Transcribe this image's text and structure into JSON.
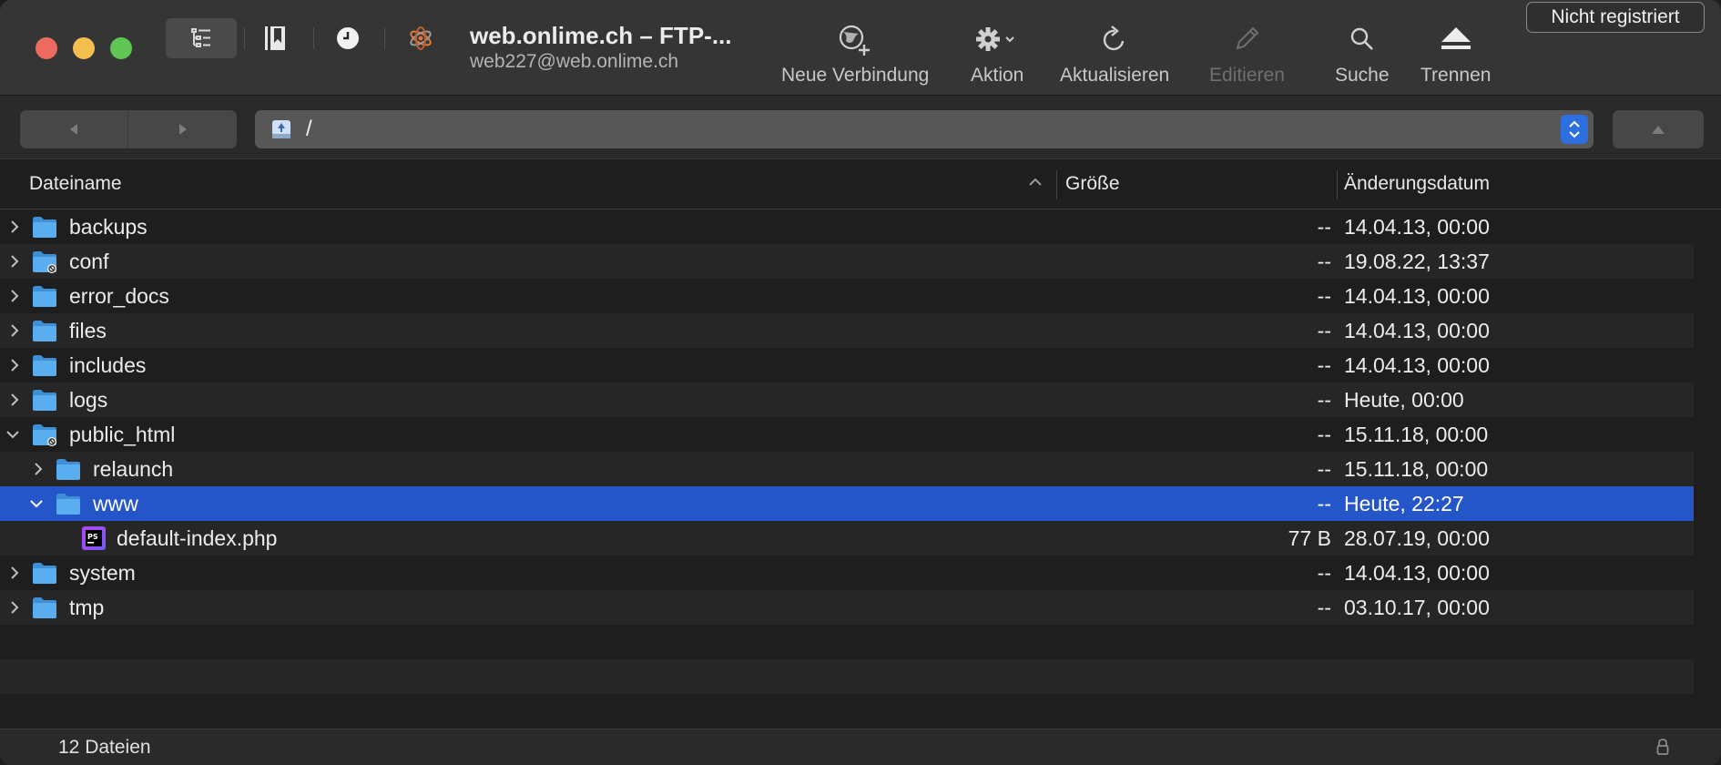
{
  "toolbar": {
    "connection_title": "web.onlime.ch – FTP-...",
    "connection_subtitle": "web227@web.onlime.ch",
    "new_connection": "Neue Verbindung",
    "action": "Aktion",
    "refresh": "Aktualisieren",
    "edit": "Editieren",
    "search": "Suche",
    "disconnect": "Trennen",
    "unregistered": "Nicht registriert"
  },
  "pathbar": {
    "path": "/"
  },
  "columns": {
    "filename": "Dateiname",
    "size": "Größe",
    "modified": "Änderungsdatum"
  },
  "files": [
    {
      "name": "backups",
      "size": "--",
      "date": "14.04.13, 00:00"
    },
    {
      "name": "conf",
      "size": "--",
      "date": "19.08.22, 13:37"
    },
    {
      "name": "error_docs",
      "size": "--",
      "date": "14.04.13, 00:00"
    },
    {
      "name": "files",
      "size": "--",
      "date": "14.04.13, 00:00"
    },
    {
      "name": "includes",
      "size": "--",
      "date": "14.04.13, 00:00"
    },
    {
      "name": "logs",
      "size": "--",
      "date": "Heute, 00:00"
    },
    {
      "name": "public_html",
      "size": "--",
      "date": "15.11.18, 00:00"
    },
    {
      "name": "relaunch",
      "size": "--",
      "date": "15.11.18, 00:00"
    },
    {
      "name": "www",
      "size": "--",
      "date": "Heute, 22:27"
    },
    {
      "name": "default-index.php",
      "size": "77 B",
      "date": "28.07.19, 00:00"
    },
    {
      "name": "system",
      "size": "--",
      "date": "14.04.13, 00:00"
    },
    {
      "name": "tmp",
      "size": "--",
      "date": "03.10.17, 00:00"
    }
  ],
  "status": {
    "count": "12 Dateien"
  },
  "colors": {
    "selection": "#2556c9",
    "folder": "#5aaef0",
    "accent": "#2e6fe0"
  }
}
